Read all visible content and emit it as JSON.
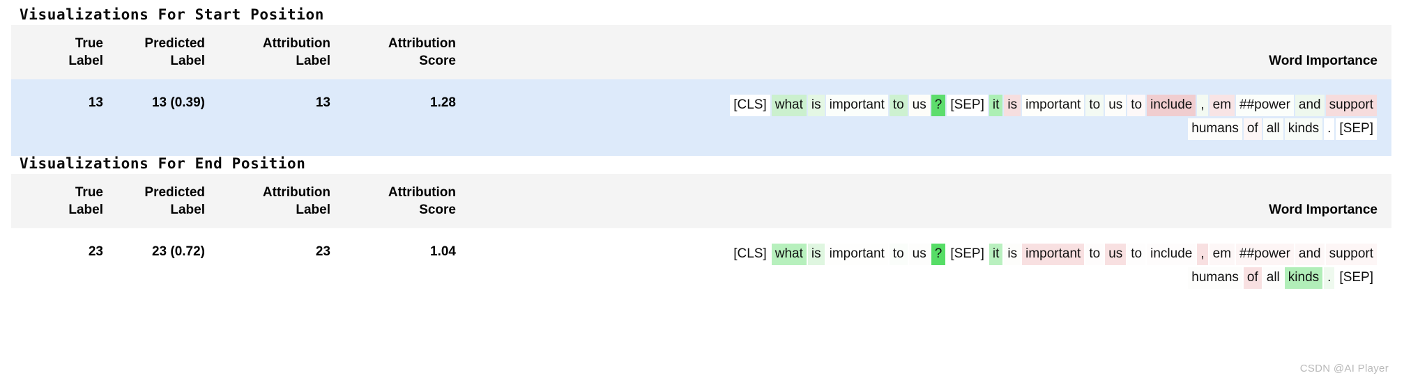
{
  "watermark": "CSDN @AI Player",
  "columns": [
    "True\nLabel",
    "Predicted\nLabel",
    "Attribution\nLabel",
    "Attribution\nScore",
    "Word Importance"
  ],
  "column_labels": {
    "true_label_line1": "True",
    "true_label_line2": "Label",
    "pred_label_line1": "Predicted",
    "pred_label_line2": "Label",
    "attr_label_line1": "Attribution",
    "attr_label_line2": "Label",
    "attr_score_line1": "Attribution",
    "attr_score_line2": "Score",
    "word_importance": "Word Importance"
  },
  "colors": {
    "header_bg": "#f4f4f4",
    "row_highlight_bg": "#ddeafa",
    "row_plain_bg": "#ffffff",
    "positive": "#4ddb63",
    "negative": "#f0c3c3",
    "text": "#000000"
  },
  "sections": [
    {
      "title": "Visualizations For Start Position",
      "row": {
        "true_label": "13",
        "predicted_label": "13 (0.39)",
        "attribution_label": "13",
        "attribution_score": "1.28",
        "row_bg": "#ddeafa",
        "tokens": [
          {
            "text": "[CLS]",
            "bg": "#ffffff"
          },
          {
            "text": "what",
            "bg": "#cbf0ce"
          },
          {
            "text": "is",
            "bg": "#e4f7e4"
          },
          {
            "text": "important",
            "bg": "#fbfefb"
          },
          {
            "text": "to",
            "bg": "#cdf1d0"
          },
          {
            "text": "us",
            "bg": "#fdfdf9"
          },
          {
            "text": "?",
            "bg": "#5ddd6d"
          },
          {
            "text": "[SEP]",
            "bg": "#ffffff"
          },
          {
            "text": "it",
            "bg": "#acefb4"
          },
          {
            "text": "is",
            "bg": "#f6dedf"
          },
          {
            "text": "important",
            "bg": "#fefefb"
          },
          {
            "text": "to",
            "bg": "#f3faf3"
          },
          {
            "text": "us",
            "bg": "#fdfdfa"
          },
          {
            "text": "to",
            "bg": "#fdf8f8"
          },
          {
            "text": "include",
            "bg": "#f0cdcf"
          },
          {
            "text": ",",
            "bg": "#f3faf2"
          },
          {
            "text": "em",
            "bg": "#f8e4e5"
          },
          {
            "text": "##power",
            "bg": "#fbfefb"
          },
          {
            "text": "and",
            "bg": "#eef8ee"
          },
          {
            "text": "support",
            "bg": "#f6dcdd"
          },
          {
            "text": "humans",
            "bg": "#fdfdfb",
            "line": 2
          },
          {
            "text": "of",
            "bg": "#fdf6f6",
            "line": 2
          },
          {
            "text": "all",
            "bg": "#fafdfa",
            "line": 2
          },
          {
            "text": "kinds",
            "bg": "#f7fbf7",
            "line": 2
          },
          {
            "text": ".",
            "bg": "#ffffff",
            "line": 2
          },
          {
            "text": "[SEP]",
            "bg": "#ffffff",
            "line": 2
          }
        ]
      }
    },
    {
      "title": "Visualizations For End Position",
      "row": {
        "true_label": "23",
        "predicted_label": "23 (0.72)",
        "attribution_label": "23",
        "attribution_score": "1.04",
        "row_bg": "#ffffff",
        "tokens": [
          {
            "text": "[CLS]",
            "bg": "#ffffff"
          },
          {
            "text": "what",
            "bg": "#b7f0bd"
          },
          {
            "text": "is",
            "bg": "#dff6e0"
          },
          {
            "text": "important",
            "bg": "#fefefd"
          },
          {
            "text": "to",
            "bg": "#fafdfa"
          },
          {
            "text": "us",
            "bg": "#fdfdfc"
          },
          {
            "text": "?",
            "bg": "#56dd66"
          },
          {
            "text": "[SEP]",
            "bg": "#ffffff"
          },
          {
            "text": "it",
            "bg": "#b9f0bf"
          },
          {
            "text": "is",
            "bg": "#fdfdfb"
          },
          {
            "text": "important",
            "bg": "#f8e0e1"
          },
          {
            "text": "to",
            "bg": "#fefcfc"
          },
          {
            "text": "us",
            "bg": "#f8e0e1"
          },
          {
            "text": "to",
            "bg": "#fefdfd"
          },
          {
            "text": "include",
            "bg": "#fefcfc"
          },
          {
            "text": ",",
            "bg": "#f8e0e1"
          },
          {
            "text": "em",
            "bg": "#fdf7f7"
          },
          {
            "text": "##power",
            "bg": "#fdf5f5"
          },
          {
            "text": "and",
            "bg": "#fdf7f7"
          },
          {
            "text": "support",
            "bg": "#fdf6f6"
          },
          {
            "text": "humans",
            "bg": "#fdfdfc",
            "line": 2
          },
          {
            "text": "of",
            "bg": "#f8e0e1",
            "line": 2
          },
          {
            "text": "all",
            "bg": "#fdfdfc",
            "line": 2
          },
          {
            "text": "kinds",
            "bg": "#b1eeb8",
            "line": 2
          },
          {
            "text": ".",
            "bg": "#eef9ee",
            "line": 2
          },
          {
            "text": "[SEP]",
            "bg": "#ffffff",
            "line": 2
          }
        ]
      }
    }
  ]
}
